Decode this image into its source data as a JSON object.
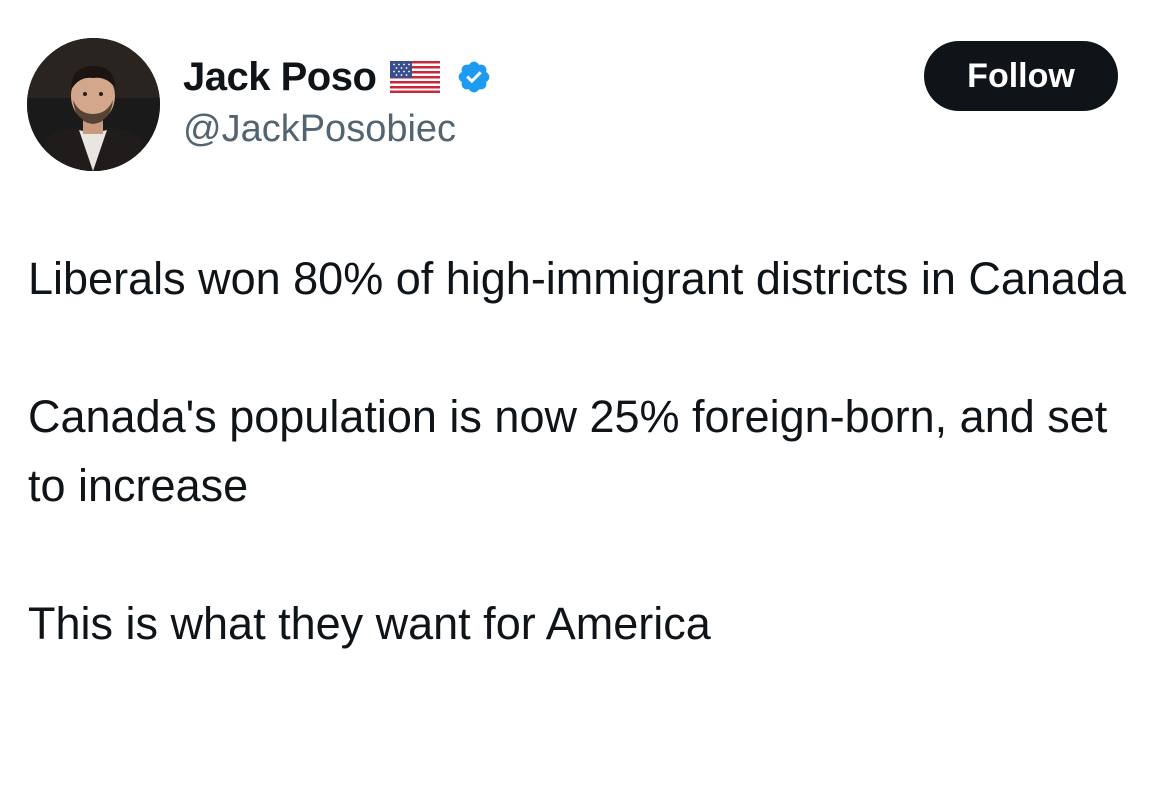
{
  "author": {
    "display_name": "Jack Poso",
    "handle": "@JackPosobiec",
    "flag_icon": "us-flag-icon",
    "verified_icon": "verified-badge-icon",
    "verified_color": "#1d9bf0"
  },
  "follow_button": {
    "label": "Follow"
  },
  "tweet": {
    "paragraphs": [
      "Liberals won 80% of high-immigrant districts in Canada",
      "Canada's population is now 25% foreign-born, and set to increase",
      "This is what they want for America"
    ]
  },
  "colors": {
    "text": "#0f1419",
    "secondary_text": "#536471",
    "button_bg": "#0f1419",
    "button_text": "#ffffff"
  }
}
